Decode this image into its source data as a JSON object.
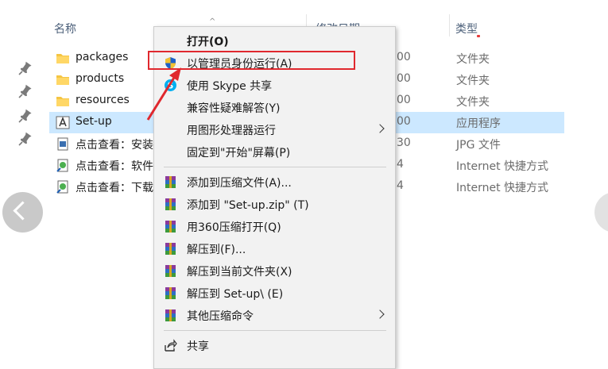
{
  "columns": {
    "name": "名称",
    "date": "修改日期",
    "type": "类型"
  },
  "files": [
    {
      "name": "packages",
      "date": "00",
      "type": "文件夹",
      "icon": "folder-icon"
    },
    {
      "name": "products",
      "date": "00",
      "type": "文件夹",
      "icon": "folder-icon"
    },
    {
      "name": "resources",
      "date": "00",
      "type": "文件夹",
      "icon": "folder-icon"
    },
    {
      "name": "Set-up",
      "date": "00",
      "type": "应用程序",
      "icon": "adobe-app-icon",
      "selected": true
    },
    {
      "name": "点击查看：安装",
      "date": "30",
      "type": "JPG 文件",
      "icon": "image-file-icon"
    },
    {
      "name": "点击查看：软件",
      "date": "4",
      "type": "Internet 快捷方式",
      "icon": "internet-shortcut-icon"
    },
    {
      "name": "点击查看：下载",
      "date": "4",
      "type": "Internet 快捷方式",
      "icon": "internet-shortcut-icon"
    }
  ],
  "context_menu": {
    "items": [
      {
        "label": "打开(O)",
        "bold": true
      },
      {
        "label": "以管理员身份运行(A)",
        "icon": "uac-shield-icon"
      },
      {
        "label": "使用 Skype 共享",
        "icon": "skype-icon"
      },
      {
        "label": "兼容性疑难解答(Y)"
      },
      {
        "label": "用图形处理器运行",
        "submenu": true
      },
      {
        "label": "固定到\"开始\"屏幕(P)"
      },
      {
        "label": "添加到压缩文件(A)...",
        "icon": "winrar-icon"
      },
      {
        "label": "添加到 \"Set-up.zip\" (T)",
        "icon": "winrar-icon"
      },
      {
        "label": "用360压缩打开(Q)",
        "icon": "winrar-icon"
      },
      {
        "label": "解压到(F)...",
        "icon": "winrar-icon"
      },
      {
        "label": "解压到当前文件夹(X)",
        "icon": "winrar-icon"
      },
      {
        "label": "解压到 Set-up\\ (E)",
        "icon": "winrar-icon"
      },
      {
        "label": "其他压缩命令",
        "icon": "winrar-icon",
        "submenu": true
      },
      {
        "label": "共享",
        "icon": "share-icon"
      }
    ]
  },
  "colors": {
    "selection": "#cce8ff",
    "annotation_red": "#e0282e",
    "menu_bg": "#f2f2f2",
    "folder": "#f5c542"
  }
}
